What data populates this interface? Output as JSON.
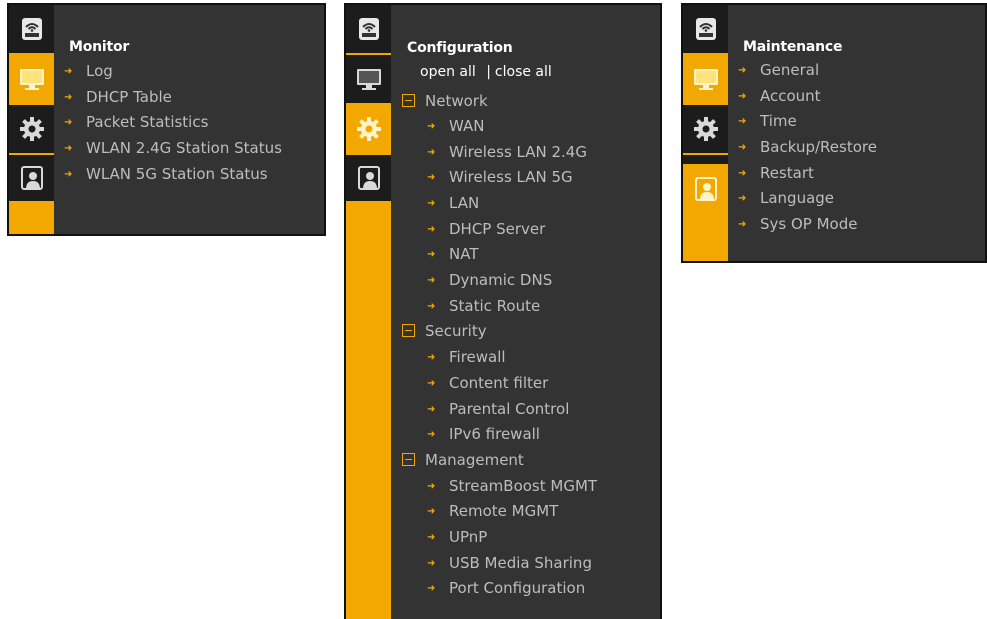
{
  "colors": {
    "accent": "#f2a800",
    "panel_bg": "#333333",
    "tile_bg": "#1c1c1c",
    "item_text": "#bdbdbd",
    "title_text": "#ffffff"
  },
  "icons": [
    "wifi-router-icon",
    "monitor-icon",
    "gear-icon",
    "user-icon"
  ],
  "monitor": {
    "title": "Monitor",
    "active_tab": "monitor",
    "items": [
      "Log",
      "DHCP Table",
      "Packet Statistics",
      "WLAN 2.4G Station Status",
      "WLAN 5G Station Status"
    ]
  },
  "configuration": {
    "title": "Configuration",
    "active_tab": "configuration",
    "open_all": "open all",
    "separator": "|",
    "close_all": "close all",
    "groups": [
      {
        "label": "Network",
        "items": [
          "WAN",
          "Wireless LAN 2.4G",
          "Wireless LAN 5G",
          "LAN",
          "DHCP Server",
          "NAT",
          "Dynamic DNS",
          "Static Route"
        ]
      },
      {
        "label": "Security",
        "items": [
          "Firewall",
          "Content filter",
          "Parental Control",
          "IPv6 firewall"
        ]
      },
      {
        "label": "Management",
        "items": [
          "StreamBoost MGMT",
          "Remote MGMT",
          "UPnP",
          "USB Media Sharing",
          "Port Configuration"
        ]
      }
    ]
  },
  "maintenance": {
    "title": "Maintenance",
    "active_tab": "maintenance",
    "items": [
      "General",
      "Account",
      "Time",
      "Backup/Restore",
      "Restart",
      "Language",
      "Sys OP Mode"
    ]
  }
}
